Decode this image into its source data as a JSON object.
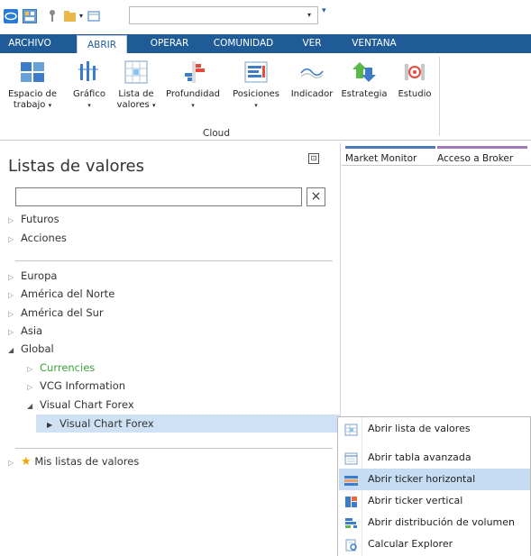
{
  "quick_access": {
    "icons": [
      "app-logo-icon",
      "layout-icon",
      "pin-icon",
      "folder-icon",
      "dropdown-icon",
      "window-icon"
    ],
    "combo_value": "",
    "extra_glyph": "▾"
  },
  "ribbon_tabs": [
    {
      "label": "ARCHIVO",
      "state": "file"
    },
    {
      "label": "ABRIR",
      "state": "active"
    },
    {
      "label": "OPERAR",
      "state": "normal"
    },
    {
      "label": "COMUNIDAD",
      "state": "normal"
    },
    {
      "label": "VER",
      "state": "normal"
    },
    {
      "label": "VENTANA",
      "state": "normal"
    }
  ],
  "ribbon_buttons": [
    {
      "line1": "Espacio de",
      "line2": "trabajo",
      "dropdown": true,
      "icon": "workspace-icon"
    },
    {
      "line1": "Gráfico",
      "line2": "",
      "dropdown": true,
      "icon": "chart-icon"
    },
    {
      "line1": "Lista de",
      "line2": "valores",
      "dropdown": true,
      "icon": "list-icon"
    },
    {
      "line1": "Profundidad",
      "line2": "",
      "dropdown": true,
      "icon": "depth-icon"
    },
    {
      "line1": "Posiciones",
      "line2": "",
      "dropdown": true,
      "icon": "positions-icon"
    },
    {
      "line1": "Indicador",
      "line2": "",
      "dropdown": false,
      "icon": "indicator-icon"
    },
    {
      "line1": "Estrategia",
      "line2": "",
      "dropdown": false,
      "icon": "strategy-icon"
    },
    {
      "line1": "Estudio",
      "line2": "",
      "dropdown": false,
      "icon": "study-icon"
    }
  ],
  "ribbon_group_label": "Cloud",
  "panel": {
    "title": "Listas de valores",
    "pin_glyph": "⊡",
    "search_value": "",
    "clear_glyph": "×"
  },
  "tree": {
    "group1": [
      {
        "label": "Futuros",
        "expanded": false
      },
      {
        "label": "Acciones",
        "expanded": false
      }
    ],
    "group2": [
      {
        "label": "Europa",
        "expanded": false
      },
      {
        "label": "América del Norte",
        "expanded": false
      },
      {
        "label": "América del Sur",
        "expanded": false
      },
      {
        "label": "Asia",
        "expanded": false
      },
      {
        "label": "Global",
        "expanded": true
      }
    ],
    "global_children": [
      {
        "label": "Currencies",
        "expanded": false,
        "color": "#3aa33a"
      },
      {
        "label": "VCG Information",
        "expanded": false
      },
      {
        "label": "Visual Chart Forex",
        "expanded": true
      }
    ],
    "forex_child": {
      "label": "Visual Chart Forex",
      "selected": true
    },
    "my_lists": {
      "label": "Mis listas de valores"
    }
  },
  "right_tabs": [
    {
      "label": "Market Monitor",
      "bar_color": "#4a7ab8"
    },
    {
      "label": "Acceso a Broker",
      "bar_color": "#a07ab8"
    }
  ],
  "context_menu": [
    {
      "label": "Abrir lista de valores",
      "icon": "list-grid-icon",
      "highlighted": false
    },
    {
      "label": "Abrir tabla avanzada",
      "icon": "table-icon",
      "highlighted": false
    },
    {
      "label": "Abrir ticker horizontal",
      "icon": "ticker-horizontal-icon",
      "highlighted": true
    },
    {
      "label": "Abrir ticker vertical",
      "icon": "ticker-vertical-icon",
      "highlighted": false
    },
    {
      "label": "Abrir distribución de volumen",
      "icon": "volume-distribution-icon",
      "highlighted": false
    },
    {
      "label": "Calcular Explorer",
      "icon": "explorer-icon",
      "highlighted": false
    }
  ],
  "colors": {
    "ribbon_blue": "#1f5c97",
    "selection": "#cfe2f5",
    "menu_highlight": "#c6dcf2",
    "green_label": "#3aa33a"
  }
}
